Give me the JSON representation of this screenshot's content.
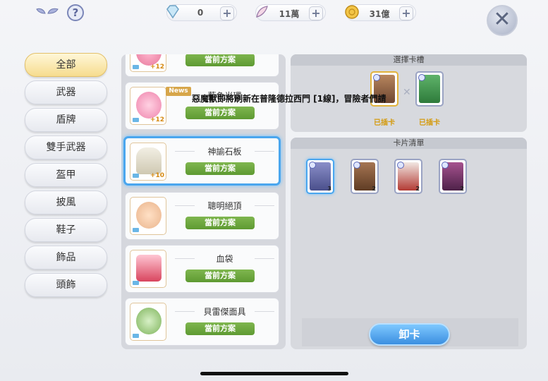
{
  "topbar": {
    "resources": [
      {
        "icon": "diamond-icon",
        "value": "0",
        "plus": "+"
      },
      {
        "icon": "feather-icon",
        "value": "11萬",
        "plus": "+"
      },
      {
        "icon": "coin-icon",
        "value": "31億",
        "plus": "+"
      }
    ],
    "help": "?",
    "close": "✕"
  },
  "categories": [
    "全部",
    "武器",
    "盾牌",
    "雙手武器",
    "盔甲",
    "披風",
    "鞋子",
    "飾品",
    "頭飾"
  ],
  "equipment_list": [
    {
      "name": "",
      "plan": "當前方案",
      "level": "+12"
    },
    {
      "name": "藍色光環",
      "plan": "當前方案",
      "level": "+12",
      "badge": "News"
    },
    {
      "name": "神諭石板",
      "plan": "當前方案",
      "level": "+10"
    },
    {
      "name": "聰明絕頂",
      "plan": "當前方案",
      "level": ""
    },
    {
      "name": "血袋",
      "plan": "當前方案",
      "level": ""
    },
    {
      "name": "貝雷傑面具",
      "plan": "當前方案",
      "level": ""
    }
  ],
  "card_slot_panel": {
    "title": "選擇卡槽",
    "slots": [
      {
        "label": "已插卡"
      },
      {
        "label": "已插卡"
      }
    ],
    "remove": "✕"
  },
  "card_list_panel": {
    "title": "卡片清單",
    "cards": [
      {
        "count": "3"
      },
      {
        "count": "2"
      },
      {
        "count": "2"
      },
      {
        "count": "2"
      }
    ]
  },
  "unload_button": "卸卡",
  "toast": "惡魔獸即將刷新在普隆德拉西門 [1線]，冒險者們請",
  "colors": {
    "accent_blue": "#4aa6ee",
    "plan_green": "#6aa63d",
    "slot_gold": "#d49b10"
  }
}
